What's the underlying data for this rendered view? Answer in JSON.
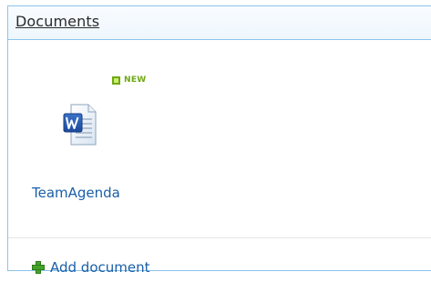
{
  "webpart": {
    "title": "Documents"
  },
  "document": {
    "name": "TeamAgenda",
    "badge": "NEW",
    "icon": "word-document-icon"
  },
  "actions": {
    "add_document": "Add document",
    "add_icon": "plus-icon"
  },
  "colors": {
    "border": "#8cc4ec",
    "link": "#1a5fa8",
    "new_badge": "#6ea814",
    "add_icon": "#43a329"
  }
}
